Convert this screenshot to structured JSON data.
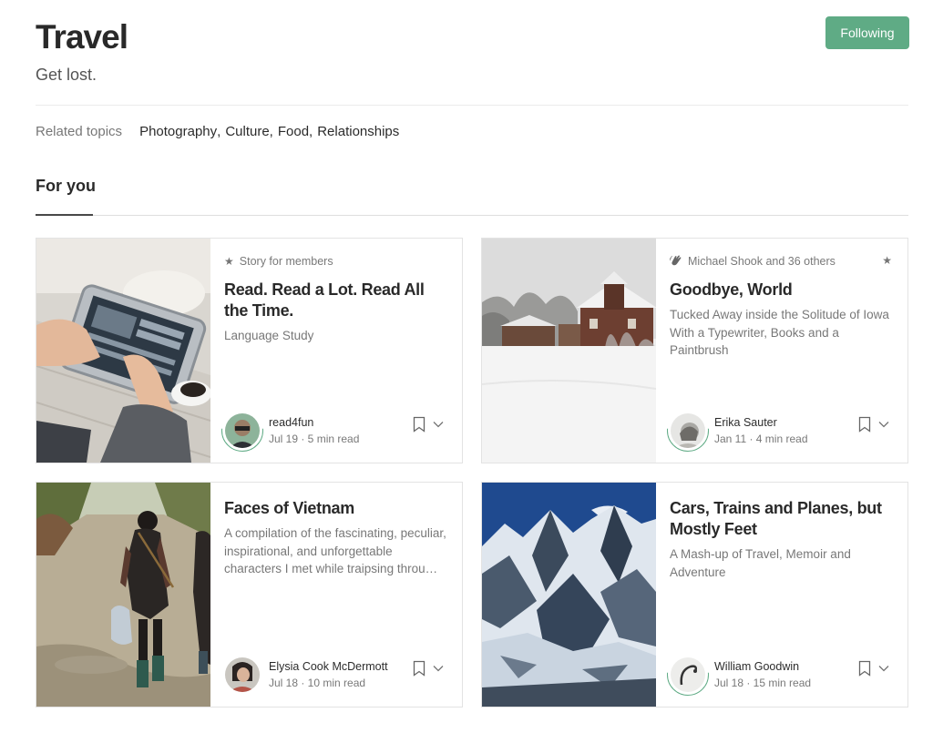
{
  "header": {
    "title": "Travel",
    "subtitle": "Get lost.",
    "follow_label": "Following"
  },
  "related": {
    "label": "Related topics",
    "topics": [
      "Photography",
      "Culture",
      "Food",
      "Relationships"
    ]
  },
  "tabs": {
    "for_you": "For you"
  },
  "cards": [
    {
      "meta_top": "Story for members",
      "title": "Read. Read a Lot. Read All the Time.",
      "subtitle": "Language Study",
      "author": "read4fun",
      "date_read": "Jul 19 · 5 min read"
    },
    {
      "meta_top": "Michael Shook and 36 others",
      "title": "Goodbye, World",
      "subtitle": "Tucked Away inside the Solitude of Iowa With a Typewriter, Books and a Paintbrush",
      "author": "Erika Sauter",
      "date_read": "Jan 11 · 4 min read"
    },
    {
      "title": "Faces of Vietnam",
      "subtitle": "A compilation of the fascinating, peculiar, inspirational, and unforgettable characters I met while traipsing throu…",
      "author": "Elysia Cook McDermott",
      "date_read": "Jul 18 · 10 min read"
    },
    {
      "title": "Cars, Trains and Planes, but Mostly Feet",
      "subtitle": "A Mash-up of Travel, Memoir and Adventure",
      "author": "William Goodwin",
      "date_read": "Jul 18 · 15 min read"
    }
  ],
  "colors": {
    "accent": "#5fab85"
  }
}
